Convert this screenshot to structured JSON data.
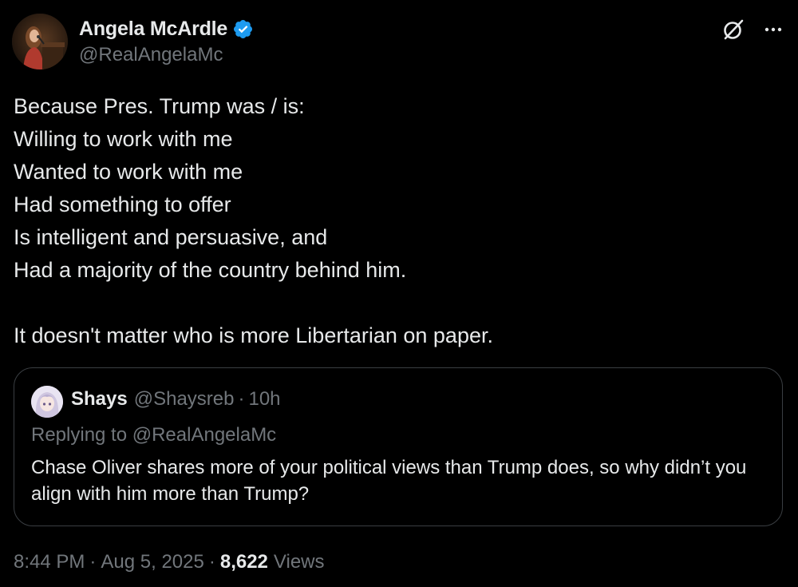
{
  "author": {
    "display_name": "Angela McArdle",
    "handle": "@RealAngelaMc",
    "verified": true,
    "verified_color": "#1d9bf0",
    "avatar_icon": "avatar-photo-speaker-at-podium"
  },
  "header_icons": {
    "grok": "grok-icon",
    "more": "more-icon",
    "more_glyph": "···"
  },
  "tweet": {
    "lines": [
      "Because Pres. Trump was / is:",
      "Willing to work with me",
      "Wanted to work with me",
      "Had something to offer",
      "Is intelligent and persuasive, and",
      "Had a majority of the country behind him.",
      "",
      "It doesn't matter who is more Libertarian on paper."
    ]
  },
  "quote": {
    "display_name": "Shays",
    "handle": "@Shaysreb",
    "separator": "·",
    "time": "10h",
    "replying_to": "Replying to @RealAngelaMc",
    "text": "Chase Oliver shares more of your political views than Trump does, so why didn’t you align with him more than Trump?",
    "avatar_icon": "avatar-anime-character"
  },
  "meta": {
    "time": "8:44 PM",
    "separator": "·",
    "date": "Aug 5, 2025",
    "views_count": "8,622",
    "views_label": "Views"
  },
  "colors": {
    "background": "#000000",
    "primary_text": "#e7e9ea",
    "secondary_text": "#71767b",
    "border": "#3a3e42"
  }
}
